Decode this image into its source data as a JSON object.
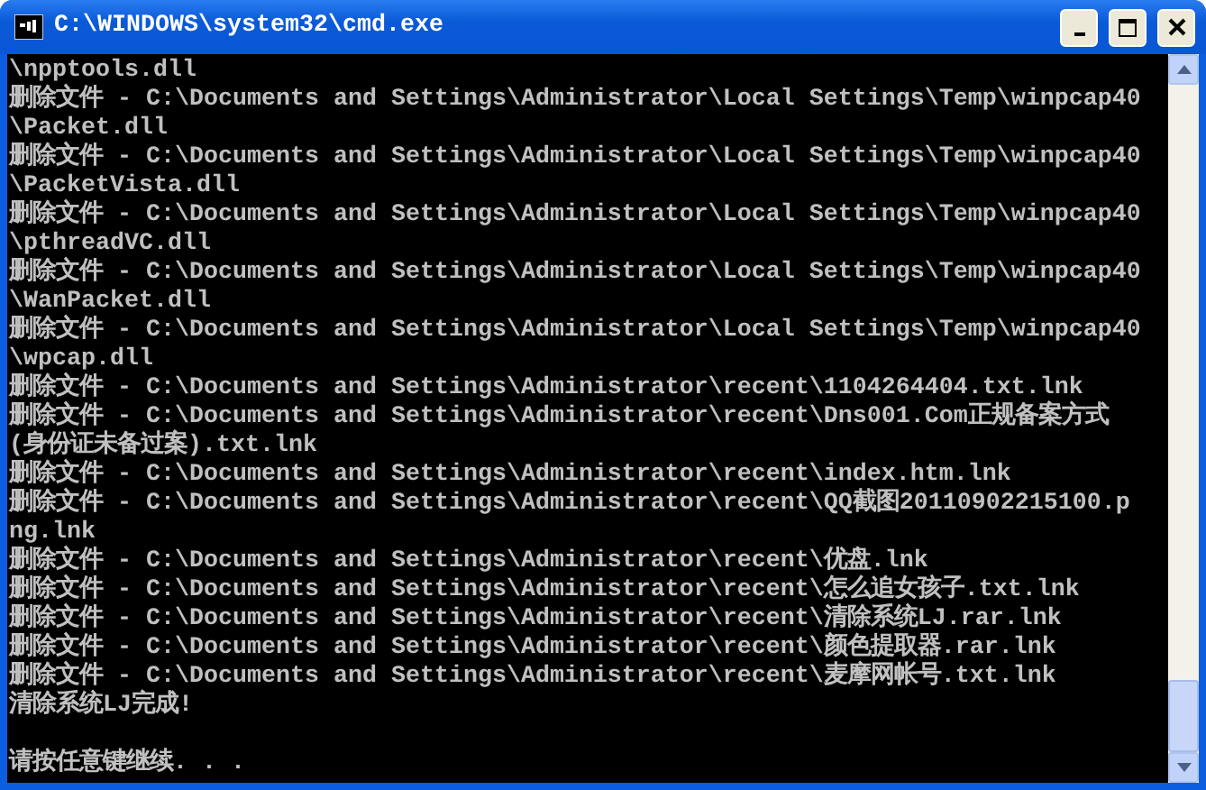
{
  "window": {
    "title": "C:\\WINDOWS\\system32\\cmd.exe"
  },
  "lines": [
    {
      "kind": "output",
      "text": "\\npptools.dll"
    },
    {
      "kind": "output",
      "text": "删除文件 - C:\\Documents and Settings\\Administrator\\Local Settings\\Temp\\winpcap40"
    },
    {
      "kind": "output",
      "text": "\\Packet.dll"
    },
    {
      "kind": "output",
      "text": "删除文件 - C:\\Documents and Settings\\Administrator\\Local Settings\\Temp\\winpcap40"
    },
    {
      "kind": "output",
      "text": "\\PacketVista.dll"
    },
    {
      "kind": "output",
      "text": "删除文件 - C:\\Documents and Settings\\Administrator\\Local Settings\\Temp\\winpcap40"
    },
    {
      "kind": "output",
      "text": "\\pthreadVC.dll"
    },
    {
      "kind": "output",
      "text": "删除文件 - C:\\Documents and Settings\\Administrator\\Local Settings\\Temp\\winpcap40"
    },
    {
      "kind": "output",
      "text": "\\WanPacket.dll"
    },
    {
      "kind": "output",
      "text": "删除文件 - C:\\Documents and Settings\\Administrator\\Local Settings\\Temp\\winpcap40"
    },
    {
      "kind": "output",
      "text": "\\wpcap.dll"
    },
    {
      "kind": "output",
      "text": "删除文件 - C:\\Documents and Settings\\Administrator\\recent\\1104264404.txt.lnk"
    },
    {
      "kind": "output",
      "text": "删除文件 - C:\\Documents and Settings\\Administrator\\recent\\Dns001.Com正规备案方式"
    },
    {
      "kind": "output",
      "text": "(身份证未备过案).txt.lnk"
    },
    {
      "kind": "output",
      "text": "删除文件 - C:\\Documents and Settings\\Administrator\\recent\\index.htm.lnk"
    },
    {
      "kind": "output",
      "text": "删除文件 - C:\\Documents and Settings\\Administrator\\recent\\QQ截图20110902215100.p"
    },
    {
      "kind": "output",
      "text": "ng.lnk"
    },
    {
      "kind": "output",
      "text": "删除文件 - C:\\Documents and Settings\\Administrator\\recent\\优盘.lnk"
    },
    {
      "kind": "output",
      "text": "删除文件 - C:\\Documents and Settings\\Administrator\\recent\\怎么追女孩子.txt.lnk"
    },
    {
      "kind": "output",
      "text": "删除文件 - C:\\Documents and Settings\\Administrator\\recent\\清除系统LJ.rar.lnk"
    },
    {
      "kind": "output",
      "text": "删除文件 - C:\\Documents and Settings\\Administrator\\recent\\颜色提取器.rar.lnk"
    },
    {
      "kind": "output",
      "text": "删除文件 - C:\\Documents and Settings\\Administrator\\recent\\麦摩网帐号.txt.lnk"
    },
    {
      "kind": "output",
      "text": "清除系统LJ完成!"
    },
    {
      "kind": "prompt",
      "text": "请按任意键继续. . ."
    }
  ]
}
